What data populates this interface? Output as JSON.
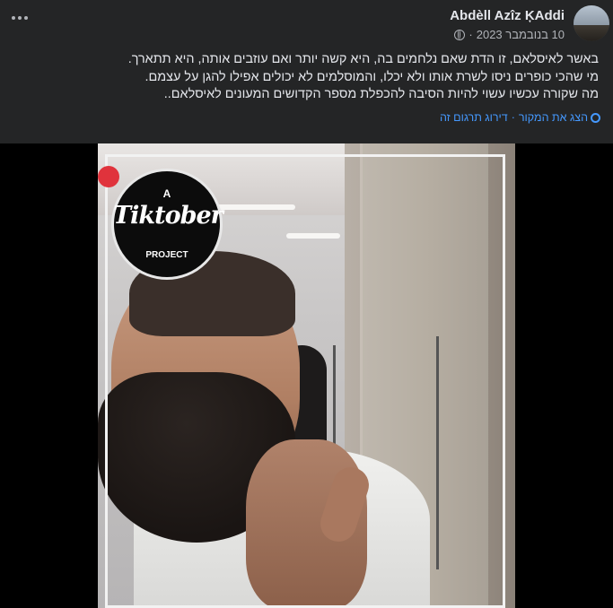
{
  "post": {
    "author": "Abdèll Azîz ĶAddi",
    "date": "10 בנובמבר 2023",
    "separator": "·",
    "privacy_icon": "globe-icon",
    "more_icon": "more-horizontal-icon",
    "text_lines": [
      "באשר לאיסלאם, זו הדת שאם נלחמים בה, היא קשה יותר ואם עוזבים אותה, היא תתארך.",
      "מי שהכי כופרים ניסו לשרת אותו ולא יכלו, והמוסלמים לא יכולים אפילו להגן על עצמם.",
      "מה שקורה עכשיו עשוי להיות הסיבה להכפלת מספר הקדושים המעונים לאיסלאם.."
    ],
    "translation": {
      "show_original": "הצג את המקור",
      "rate_translation": "דירוג תרגום זה",
      "separator": "·",
      "icon": "gear-icon"
    }
  },
  "video": {
    "watermark": {
      "top": "A",
      "name": "Tiktober",
      "bottom": "PROJECT"
    }
  },
  "colors": {
    "background": "#242526",
    "text": "#e4e6eb",
    "secondary": "#b0b3b8",
    "link": "#4599ff"
  }
}
